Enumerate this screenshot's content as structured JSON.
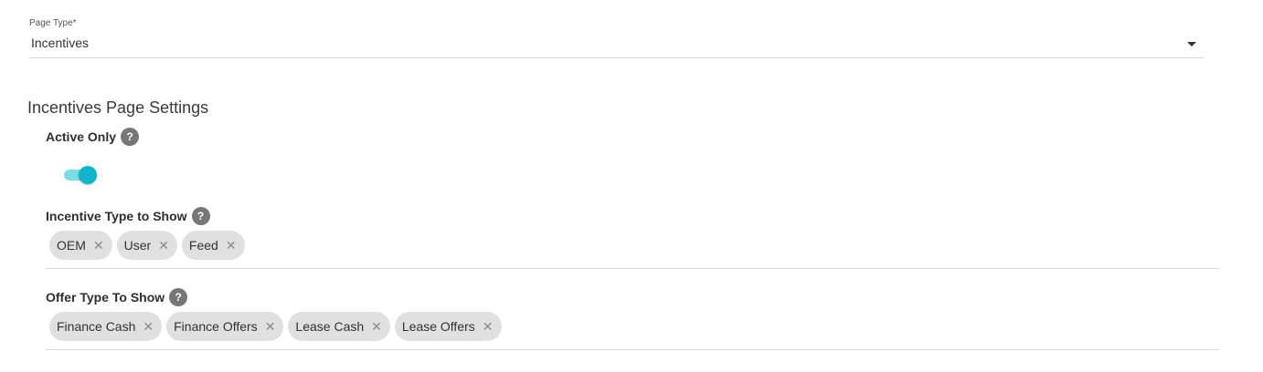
{
  "page_type": {
    "label": "Page Type*",
    "value": "Incentives"
  },
  "section": {
    "title": "Incentives Page Settings"
  },
  "active_only": {
    "label": "Active Only",
    "help": "?",
    "enabled": true,
    "accent_color": "#10b5cc"
  },
  "incentive_type": {
    "label": "Incentive Type to Show",
    "help": "?",
    "chips": [
      "OEM",
      "User",
      "Feed"
    ]
  },
  "offer_type": {
    "label": "Offer Type To Show",
    "help": "?",
    "chips": [
      "Finance Cash",
      "Finance Offers",
      "Lease Cash",
      "Lease Offers"
    ]
  },
  "icons": {
    "remove_chip": "✕",
    "help": "help-icon",
    "dropdown": "caret-down-icon"
  }
}
